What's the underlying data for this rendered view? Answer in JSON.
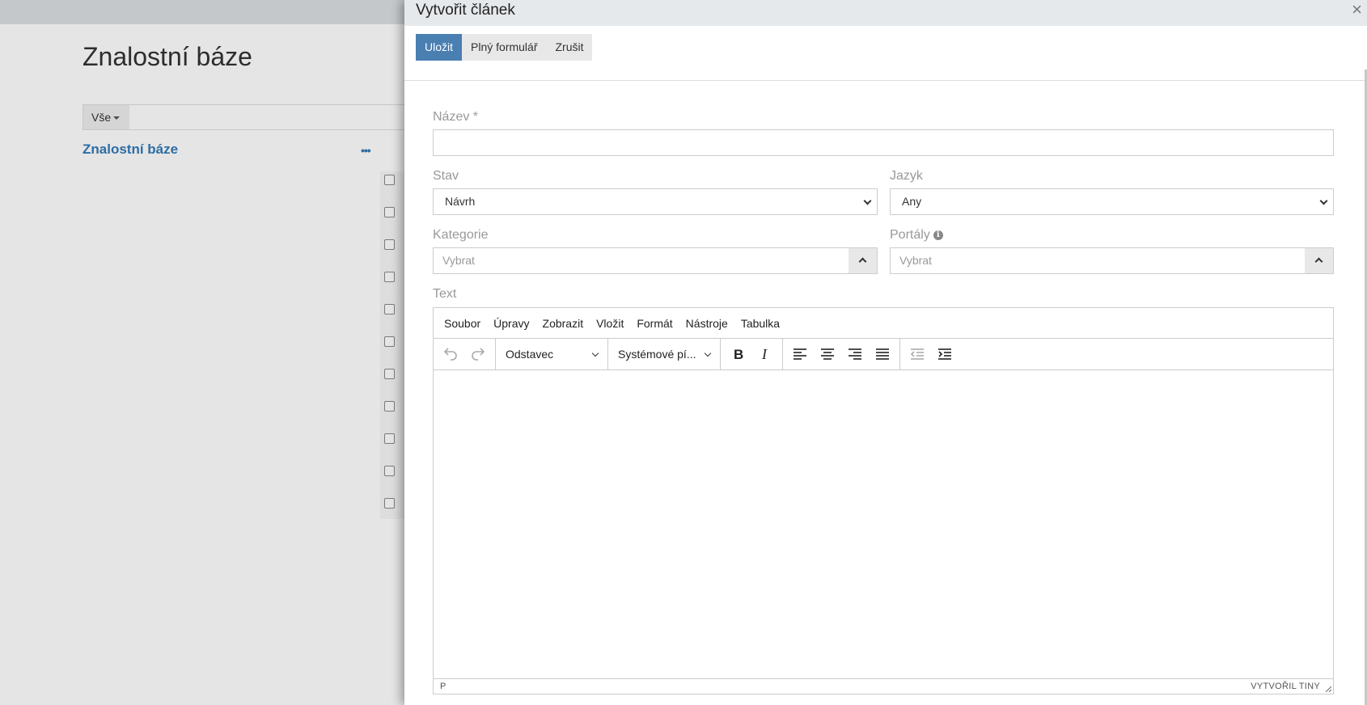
{
  "background": {
    "title": "Znalostní báze",
    "filter_label": "Vše",
    "section_title": "Znalostní báze",
    "section_menu": "•••",
    "row_count": 11
  },
  "modal": {
    "title": "Vytvořit článek",
    "close": "×",
    "buttons": {
      "save": "Uložit",
      "full_form": "Plný formulář",
      "cancel": "Zrušit"
    },
    "fields": {
      "name_label": "Název *",
      "name_value": "",
      "status_label": "Stav",
      "status_value": "Návrh",
      "language_label": "Jazyk",
      "language_value": "Any",
      "category_label": "Kategorie",
      "category_placeholder": "Vybrat",
      "portals_label": "Portály",
      "portals_placeholder": "Vybrat",
      "text_label": "Text"
    },
    "editor": {
      "menu": [
        "Soubor",
        "Úpravy",
        "Zobrazit",
        "Vložit",
        "Formát",
        "Nástroje",
        "Tabulka"
      ],
      "block_format": "Odstavec",
      "font_family": "Systémové pí...",
      "status_path": "P",
      "branding": "VYTVOŘIL TINY"
    }
  }
}
